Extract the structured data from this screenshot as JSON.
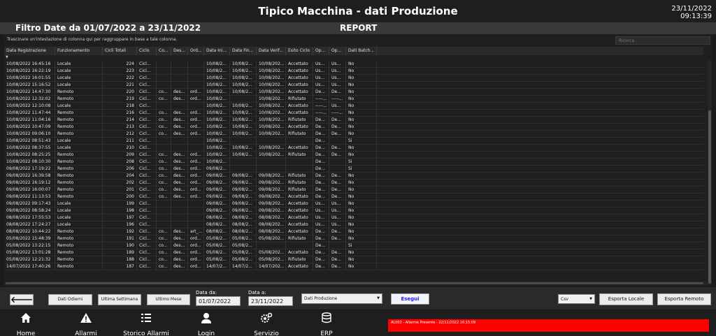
{
  "header": {
    "title": "Tipico Macchina  - dati Produzione",
    "date": "23/11/2022",
    "time": "09:13:39"
  },
  "filter": {
    "text": "Filtro Date da 01/07/2022 a 23/11/2022",
    "report": "REPORT"
  },
  "grid": {
    "group_hint": "Trascinare un'intestazione di colonna qui per raggruppare in base a tale colonna.",
    "search_placeholder": "Ricerca",
    "columns": [
      "Data Registrazione",
      "Funzionamento",
      "Cicli Totali",
      "Ciclo",
      "Co...",
      "Des...",
      "Ord...",
      "Data Ini...",
      "Data Fin...",
      "Data Verif...",
      "Esito Ciclo",
      "Op...",
      "Op...",
      "Dati Batch..."
    ],
    "rows": [
      [
        "10/08/2022 16:45:16",
        "Locale",
        "224",
        "Cicl...",
        "",
        "",
        "",
        "10/08/2...",
        "10/08/2...",
        "10/08/202...",
        "Accettato",
        "Us...",
        "Us...",
        "No"
      ],
      [
        "10/08/2022 16:22:19",
        "Locale",
        "223",
        "Cicl...",
        "",
        "",
        "",
        "10/08/2...",
        "10/08/2...",
        "10/08/202...",
        "Accettato",
        "Us...",
        "Us...",
        "No"
      ],
      [
        "10/08/2022 16:01:55",
        "Locale",
        "222",
        "Cicl...",
        "",
        "",
        "",
        "10/08/2...",
        "10/08/2...",
        "10/08/202...",
        "Accettato",
        "Us...",
        "Us...",
        "No"
      ],
      [
        "10/08/2022 15:16:52",
        "Locale",
        "221",
        "Cicl...",
        "",
        "",
        "",
        "10/08/2...",
        "10/08/2...",
        "10/08/202...",
        "Accettato",
        "Us...",
        "Us...",
        "No"
      ],
      [
        "10/08/2022 14:47:30",
        "Remoto",
        "220",
        "Cicl...",
        "co...",
        "des...",
        "ord...",
        "10/08/2...",
        "10/08/2...",
        "10/08/202...",
        "Accettato",
        "De...",
        "De...",
        "No"
      ],
      [
        "10/08/2022 12:32:02",
        "Remoto",
        "219",
        "Cicl...",
        "co...",
        "des...",
        "ord...",
        "10/08/2...",
        "",
        "10/08/202...",
        "Rifiutato",
        "-----...",
        "-----...",
        "No"
      ],
      [
        "10/08/2022 12:10:08",
        "Locale",
        "218",
        "Cicl...",
        "",
        "",
        "",
        "10/08/2...",
        "10/08/2...",
        "10/08/202...",
        "Accettato",
        "-----...",
        "Us...",
        "No"
      ],
      [
        "10/08/2022 11:47:44",
        "Remoto",
        "216",
        "Cicl...",
        "co...",
        "des...",
        "ord...",
        "10/08/2...",
        "10/08/2...",
        "10/08/202...",
        "Accettato",
        "-----...",
        "-----...",
        "No"
      ],
      [
        "10/08/2022 11:04:16",
        "Remoto",
        "214",
        "Cicl...",
        "co...",
        "des...",
        "ord...",
        "10/08/2...",
        "10/08/2...",
        "10/08/202...",
        "Rifiutato",
        "De...",
        "De...",
        "No"
      ],
      [
        "10/08/2022 10:47:09",
        "Remoto",
        "213",
        "Cicl...",
        "co...",
        "des...",
        "ord...",
        "10/08/2...",
        "10/08/2...",
        "10/08/202...",
        "Accettato",
        "De...",
        "De...",
        "No"
      ],
      [
        "10/08/2022 09:06:10",
        "Remoto",
        "212",
        "Cicl...",
        "co...",
        "des...",
        "ord...",
        "10/08/2...",
        "10/08/2...",
        "10/08/202...",
        "Rifiutato",
        "De...",
        "De...",
        "No"
      ],
      [
        "10/08/2022 08:51:43",
        "Locale",
        "211",
        "Cicl...",
        "",
        "",
        "",
        "10/08/2...",
        "",
        "",
        "",
        "De...",
        "",
        "Si"
      ],
      [
        "10/08/2022 08:37:55",
        "Locale",
        "210",
        "Cicl...",
        "",
        "",
        "",
        "10/08/2...",
        "10/08/2...",
        "10/08/202...",
        "Accettato",
        "De...",
        "De...",
        "No"
      ],
      [
        "10/08/2022 08:25:25",
        "Remoto",
        "209",
        "Cicl...",
        "co...",
        "des...",
        "ord...",
        "10/08/2...",
        "10/08/2...",
        "10/08/202...",
        "Rifiutato",
        "De...",
        "De...",
        "No"
      ],
      [
        "10/08/2022 08:10:30",
        "Remoto",
        "208",
        "Cicl...",
        "co...",
        "des...",
        "ord...",
        "10/08/2...",
        "",
        "",
        "",
        "De...",
        "",
        "Si"
      ],
      [
        "09/08/2022 17:19:22",
        "Remoto",
        "206",
        "Cicl...",
        "co...",
        "des...",
        "ord...",
        "09/08/2...",
        "",
        "",
        "",
        "De...",
        "",
        "Si"
      ],
      [
        "09/08/2022 16:39:58",
        "Remoto",
        "204",
        "Cicl...",
        "co...",
        "des...",
        "ord...",
        "09/08/2...",
        "09/08/2...",
        "09/08/202...",
        "Rifiutato",
        "De...",
        "De...",
        "No"
      ],
      [
        "09/08/2022 16:19:12",
        "Remoto",
        "202",
        "Cicl...",
        "co...",
        "des...",
        "ord...",
        "09/08/2...",
        "09/08/2...",
        "09/08/202...",
        "Rifiutato",
        "De...",
        "De...",
        "No"
      ],
      [
        "09/08/2022 16:00:07",
        "Remoto",
        "201",
        "Cicl...",
        "co...",
        "des...",
        "ord...",
        "09/08/2...",
        "09/08/2...",
        "09/08/202...",
        "Rifiutato",
        "De...",
        "De...",
        "No"
      ],
      [
        "09/08/2022 11:13:53",
        "Remoto",
        "200",
        "Cicl...",
        "co...",
        "des...",
        "ord...",
        "09/08/2...",
        "09/08/2...",
        "09/08/202...",
        "Accettato",
        "De...",
        "De...",
        "No"
      ],
      [
        "09/08/2022 09:17:43",
        "Locale",
        "199",
        "Cicl...",
        "",
        "",
        "",
        "09/08/2...",
        "09/08/2...",
        "09/08/202...",
        "Accettato",
        "Us...",
        "Us...",
        "No"
      ],
      [
        "09/08/2022 08:58:24",
        "Locale",
        "198",
        "Cicl...",
        "",
        "",
        "",
        "09/08/2...",
        "09/08/2...",
        "09/08/202...",
        "Accettato",
        "Us...",
        "Us...",
        "No"
      ],
      [
        "08/08/2022 17:55:53",
        "Locale",
        "197",
        "Cicl...",
        "",
        "",
        "",
        "08/08/2...",
        "08/08/2...",
        "08/08/202...",
        "Accettato",
        "Us...",
        "Us...",
        "No"
      ],
      [
        "08/08/2022 17:24:27",
        "Locale",
        "196",
        "Cicl...",
        "",
        "",
        "",
        "08/08/2...",
        "08/08/2...",
        "08/08/202...",
        "Accettato",
        "Us...",
        "Us...",
        "No"
      ],
      [
        "08/08/2022 10:44:22",
        "Remoto",
        "192",
        "Cicl...",
        "co...",
        "des...",
        "art_...",
        "08/08/2...",
        "08/08/2...",
        "08/08/202...",
        "Accettato",
        "De...",
        "De...",
        "No"
      ],
      [
        "05/08/2022 15:48:39",
        "Remoto",
        "191",
        "Cicl...",
        "co...",
        "des...",
        "ord...",
        "05/08/2...",
        "05/08/2...",
        "05/08/202...",
        "Rifiutato",
        "De...",
        "De...",
        "No"
      ],
      [
        "05/08/2022 13:22:15",
        "Remoto",
        "190",
        "Cicl...",
        "co...",
        "des...",
        "ord...",
        "05/08/2...",
        "05/08/2...",
        "",
        "",
        "De...",
        "",
        "Si"
      ],
      [
        "05/08/2022 13:01:28",
        "Remoto",
        "189",
        "Cicl...",
        "co...",
        "des...",
        "ord...",
        "05/08/2...",
        "05/08/2...",
        "05/08/202...",
        "Accettato",
        "De...",
        "De...",
        "No"
      ],
      [
        "05/08/2022 12:21:32",
        "Remoto",
        "188",
        "Cicl...",
        "co...",
        "des...",
        "ord...",
        "05/08/2...",
        "05/08/2...",
        "05/08/202...",
        "Rifiutato",
        "De...",
        "De...",
        "No"
      ],
      [
        "14/07/2022 17:40:26",
        "Remoto",
        "187",
        "Cicl...",
        "co...",
        "des...",
        "ord...",
        "14/07/2...",
        "14/07/2...",
        "14/07/202...",
        "Accettato",
        "De...",
        "De...",
        "No"
      ]
    ]
  },
  "controls": {
    "back_label": "🡐",
    "today": "Dati Odierni",
    "week": "Ultima Settimana",
    "month": "Ultimo Mese",
    "date_from_label": "Data da:",
    "date_from": "01/07/2022",
    "date_to_label": "Data a:",
    "date_to": "23/11/2022",
    "data_type": "Dati Produzione",
    "execute": "Esegui",
    "export_format": "Csv",
    "export_local": "Esporta Locale",
    "export_remote": "Esporta Remoto"
  },
  "nav": {
    "home": "Home",
    "alarms": "Allarmi",
    "alarm_history": "Storico Allarmi",
    "login": "Login",
    "service": "Servizio",
    "erp": "ERP"
  },
  "alarm": {
    "text": "AL002 - Allarme Presente - 22/11/2022 16:15:09",
    "color": "#ff0000"
  }
}
